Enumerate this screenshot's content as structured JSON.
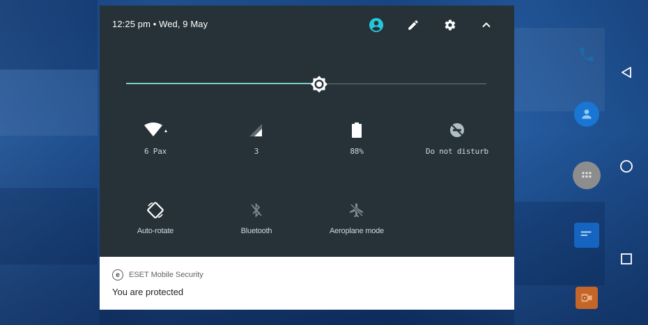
{
  "status_bar": {
    "time_date": "12:25 pm • Wed, 9 May",
    "icons": [
      "account-icon",
      "edit-icon",
      "settings-icon",
      "collapse-icon"
    ]
  },
  "brightness": {
    "level": 0.54
  },
  "tiles": [
    {
      "id": "wifi",
      "label": "6 Pax",
      "icon": "wifi-icon"
    },
    {
      "id": "mobile",
      "label": "3",
      "icon": "cellular-signal-icon"
    },
    {
      "id": "battery",
      "label": "88%",
      "icon": "battery-icon"
    },
    {
      "id": "dnd",
      "label": "Do not disturb",
      "icon": "do-not-disturb-icon"
    },
    {
      "id": "rotate",
      "label": "Auto-rotate",
      "icon": "auto-rotate-icon"
    },
    {
      "id": "bluetooth",
      "label": "Bluetooth",
      "icon": "bluetooth-off-icon"
    },
    {
      "id": "aeroplane",
      "label": "Aeroplane mode",
      "icon": "airplane-mode-off-icon"
    }
  ],
  "notification": {
    "app_name": "ESET Mobile Security",
    "app_badge": "e",
    "text": "You are protected"
  },
  "navbar": {
    "buttons": [
      "back-icon",
      "home-icon",
      "recents-icon"
    ]
  },
  "colors": {
    "shade_bg": "#263238",
    "accent": "#80cbc4",
    "account_icon": "#26c6da",
    "wallpaper": "#1f4f8f"
  }
}
